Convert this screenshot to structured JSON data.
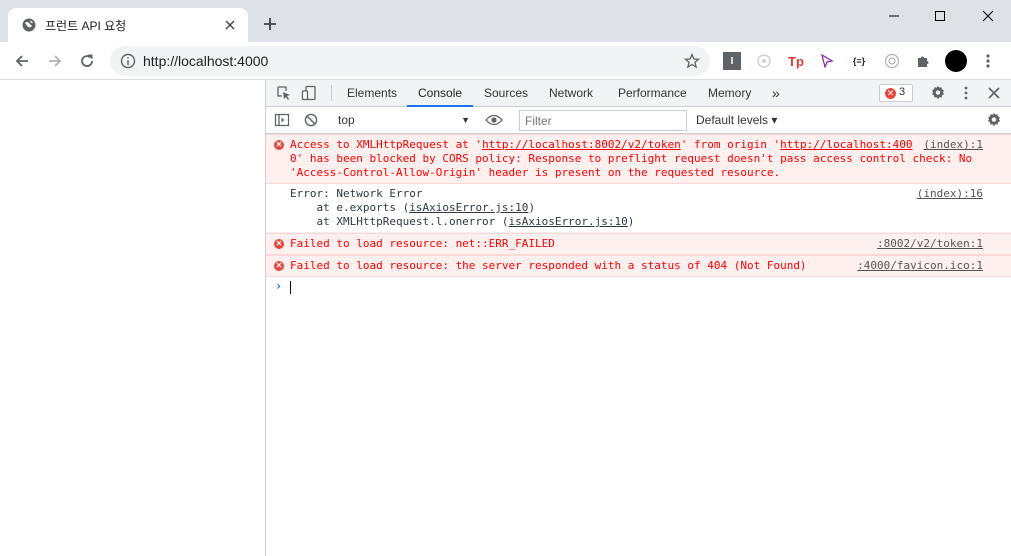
{
  "tab": {
    "title": "프런트 API 요청"
  },
  "toolbar": {
    "url": "http://localhost:4000",
    "extensions": [
      "ext-i",
      "ext-puzzle-gear",
      "Tp",
      "ext-arrow",
      "{≡}",
      "ext-target",
      "extensions-icon",
      "profile-avatar",
      "menu-icon"
    ],
    "ext_tp_label": "Tp",
    "ext_json_label": "{≡}"
  },
  "devtools": {
    "tabs": [
      {
        "label": "Elements"
      },
      {
        "label": "Console",
        "active": true
      },
      {
        "label": "Sources"
      },
      {
        "label": "Network"
      },
      {
        "label": "Performance"
      },
      {
        "label": "Memory"
      }
    ],
    "more_tabs": "»",
    "error_count": "3",
    "context": "top",
    "filter_placeholder": "Filter",
    "levels": "Default levels ▾"
  },
  "console": {
    "messages": [
      {
        "type": "error",
        "lines": [
          [
            "Access to XMLHttpRequest at '",
            {
              "link": "http://localhost:8002/v2/token"
            },
            "' from origin '",
            {
              "link": "http://localhost:400"
            }
          ],
          [
            "0' has been blocked by CORS policy: Response to preflight request doesn't pass access control check: No"
          ],
          [
            "'Access-Control-Allow-Origin' header is present on the requested resource."
          ]
        ],
        "source": "(index):1"
      },
      {
        "type": "plain",
        "line1": "Error: Network Error",
        "line2_prefix": "    at e.exports (",
        "line2_link": "isAxiosError.js:10",
        "line2_suffix": ")",
        "line3_prefix": "    at XMLHttpRequest.l.onerror (",
        "line3_link": "isAxiosError.js:10",
        "line3_suffix": ")",
        "source": "(index):16"
      },
      {
        "type": "error",
        "text": "Failed to load resource: net::ERR_FAILED",
        "source": ":8002/v2/token:1"
      },
      {
        "type": "error",
        "text": "Failed to load resource: the server responded with a status of 404 (Not Found)",
        "source": ":4000/favicon.ico:1"
      }
    ],
    "prompt": "›"
  },
  "colors": {
    "accent": "#1a73e8",
    "error_red": "#ff0000",
    "error_bg": "#fff0f0",
    "tabbar_bg": "#dee1e6"
  }
}
